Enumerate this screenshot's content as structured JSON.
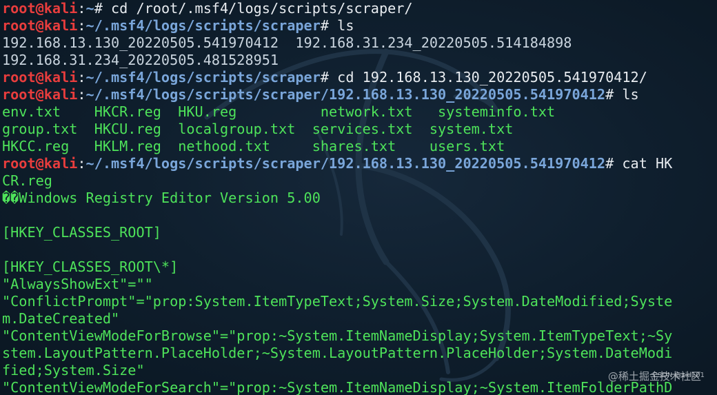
{
  "prompt": {
    "user": "root@kali",
    "colon": ":",
    "end": "# "
  },
  "lines": [
    {
      "kind": "prompt",
      "path": "~",
      "cmd": "cd /root/.msf4/logs/scripts/scraper/"
    },
    {
      "kind": "prompt",
      "path": "~/.msf4/logs/scripts/scraper",
      "cmd": "ls"
    },
    {
      "kind": "out",
      "text": "192.168.13.130_20220505.541970412  192.168.31.234_20220505.514184898"
    },
    {
      "kind": "out",
      "text": "192.168.31.234_20220505.481528951"
    },
    {
      "kind": "prompt",
      "path": "~/.msf4/logs/scripts/scraper",
      "cmd": "cd 192.168.13.130_20220505.541970412/"
    },
    {
      "kind": "prompt",
      "path": "~/.msf4/logs/scripts/scraper/192.168.13.130_20220505.541970412",
      "cmd": "ls"
    },
    {
      "kind": "green",
      "text": "env.txt    HKCR.reg  HKU.reg          network.txt   systeminfo.txt"
    },
    {
      "kind": "green",
      "text": "group.txt  HKCU.reg  localgroup.txt  services.txt  system.txt"
    },
    {
      "kind": "green",
      "text": "HKCC.reg   HKLM.reg  nethood.txt     shares.txt    users.txt"
    },
    {
      "kind": "prompt",
      "path": "~/.msf4/logs/scripts/scraper/192.168.13.130_20220505.541970412",
      "cmd": "cat HK"
    },
    {
      "kind": "green",
      "text": "CR.reg"
    },
    {
      "kind": "green",
      "text": "��Windows Registry Editor Version 5.00"
    },
    {
      "kind": "green",
      "text": ""
    },
    {
      "kind": "green",
      "text": "[HKEY_CLASSES_ROOT]"
    },
    {
      "kind": "green",
      "text": ""
    },
    {
      "kind": "green",
      "text": "[HKEY_CLASSES_ROOT\\*]"
    },
    {
      "kind": "green",
      "text": "\"AlwaysShowExt\"=\"\""
    },
    {
      "kind": "green",
      "text": "\"ConflictPrompt\"=\"prop:System.ItemTypeText;System.Size;System.DateModified;Syste"
    },
    {
      "kind": "green",
      "text": "m.DateCreated\""
    },
    {
      "kind": "green",
      "text": "\"ContentViewModeForBrowse\"=\"prop:~System.ItemNameDisplay;System.ItemTypeText;~Sy"
    },
    {
      "kind": "green",
      "text": "stem.LayoutPattern.PlaceHolder;~System.LayoutPattern.PlaceHolder;System.DateModi"
    },
    {
      "kind": "green",
      "text": "fied;System.Size\""
    },
    {
      "kind": "green",
      "text": "\"ContentViewModeForSearch\"=\"prop:~System.ItemNameDisplay;~System.ItemFolderPathD"
    }
  ],
  "watermark": {
    "main": "@稀土掘金技术社区",
    "sub": "CSDN @sid101"
  }
}
